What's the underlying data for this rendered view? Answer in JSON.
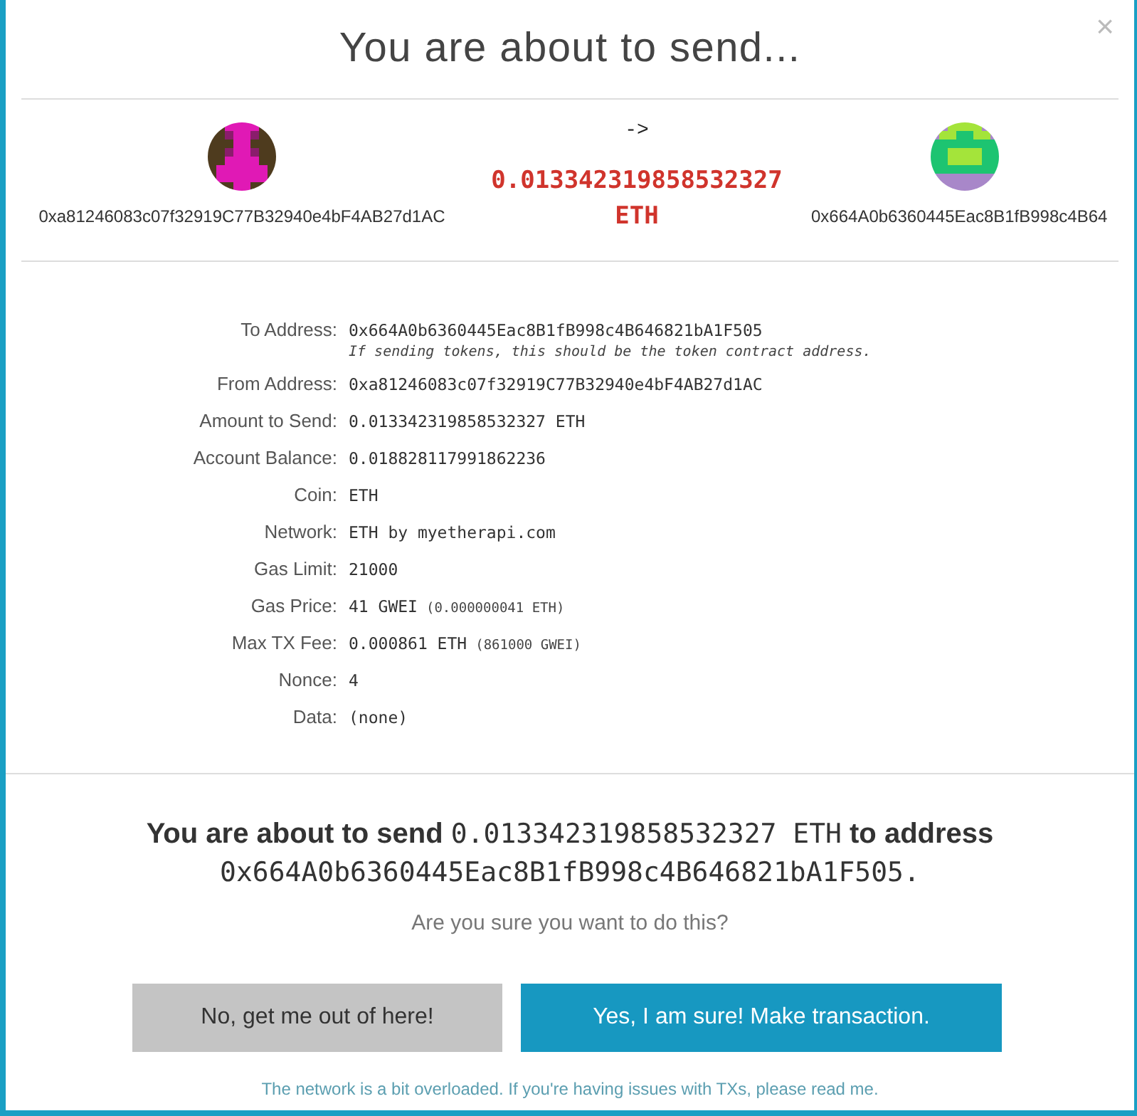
{
  "modal": {
    "title": "You are about to send...",
    "close": "×"
  },
  "transfer": {
    "from_address": "0xa81246083c07f32919C77B32940e4bF4AB27d1AC",
    "arrow": "->",
    "amount": "0.013342319858532327",
    "unit": "ETH",
    "to_address": "0x664A0b6360445Eac8B1fB998c4B64"
  },
  "details": [
    {
      "label": "To Address:",
      "value": "0x664A0b6360445Eac8B1fB998c4B646821bA1F505",
      "note": "If sending tokens, this should be the token contract address."
    },
    {
      "label": "From Address:",
      "value": "0xa81246083c07f32919C77B32940e4bF4AB27d1AC"
    },
    {
      "label": "Amount to Send:",
      "value": "0.013342319858532327 ETH"
    },
    {
      "label": "Account Balance:",
      "value": "0.018828117991862236"
    },
    {
      "label": "Coin:",
      "value": "ETH"
    },
    {
      "label": "Network:",
      "value": "ETH by myetherapi.com"
    },
    {
      "label": "Gas Limit:",
      "value": "21000"
    },
    {
      "label": "Gas Price:",
      "value": "41 GWEI",
      "extra": "(0.000000041 ETH)"
    },
    {
      "label": "Max TX Fee:",
      "value": "0.000861 ETH",
      "extra": "(861000 GWEI)"
    },
    {
      "label": "Nonce:",
      "value": "4"
    },
    {
      "label": "Data:",
      "value": "(none)"
    }
  ],
  "summary": {
    "lead": "You are about to send",
    "amount": "0.013342319858532327 ETH",
    "middle": "to address",
    "address": "0x664A0b6360445Eac8B1fB998c4B646821bA1F505."
  },
  "question": "Are you sure you want to do this?",
  "buttons": [
    {
      "label": "No, get me out of here!",
      "kind": "cancel"
    },
    {
      "label": "Yes, I am sure! Make transaction.",
      "kind": "confirm"
    }
  ],
  "footer_link": "The network is a bit overloaded. If you're having issues with TXs, please read me."
}
